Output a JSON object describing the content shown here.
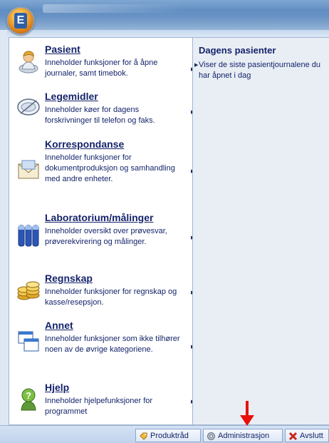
{
  "menu": {
    "items": [
      {
        "title": "Pasient",
        "description": "Inneholder funksjoner for å åpne journaler, samt timebok.",
        "icon": "patient-icon"
      },
      {
        "title": "Legemidler",
        "description": "Inneholder køer for dagens forskrivninger til telefon og faks.",
        "icon": "medicine-icon"
      },
      {
        "title": "Korrespondanse",
        "description": "Inneholder funksjoner for dokumentproduksjon og samhandling med andre enheter.",
        "icon": "envelope-icon"
      },
      {
        "title": "Laboratorium/målinger",
        "description": "Inneholder oversikt over prøvesvar, prøverekvirering og målinger.",
        "icon": "test-tubes-icon"
      },
      {
        "title": "Regnskap",
        "description": "Inneholder funksjoner for regnskap og kasse/resepsjon.",
        "icon": "coins-icon"
      },
      {
        "title": "Annet",
        "description": "Inneholder funksjoner som ikke tilhører noen av de øvrige kategoriene.",
        "icon": "windows-icon"
      },
      {
        "title": "Hjelp",
        "description": "Inneholder hjelpefunksjoner for programmet",
        "icon": "help-person-icon"
      }
    ]
  },
  "right_pane": {
    "title": "Dagens pasienter",
    "description": "Viser de siste pasientjournalene du har åpnet i dag"
  },
  "footer": {
    "produktrad": "Produktråd",
    "administrasjon": "Administrasjon",
    "avslutt": "Avslutt"
  },
  "colors": {
    "text": "#15246b",
    "annotation_arrow": "#e8100c"
  }
}
